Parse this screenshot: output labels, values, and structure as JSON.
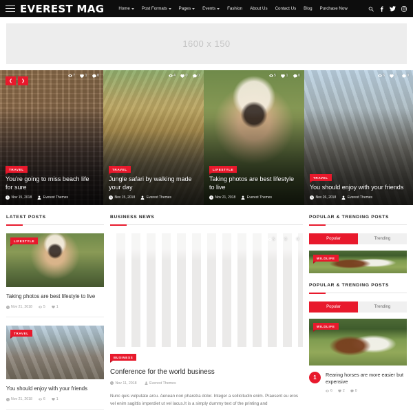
{
  "header": {
    "brand": "EVEREST MAG",
    "menu": [
      {
        "label": "Home",
        "has_dropdown": true
      },
      {
        "label": "Post Formats",
        "has_dropdown": true
      },
      {
        "label": "Pages",
        "has_dropdown": true
      },
      {
        "label": "Events",
        "has_dropdown": true
      },
      {
        "label": "Fashion",
        "has_dropdown": false
      },
      {
        "label": "About Us",
        "has_dropdown": false
      },
      {
        "label": "Contact Us",
        "has_dropdown": false
      },
      {
        "label": "Blog",
        "has_dropdown": false
      },
      {
        "label": "Purchase Now",
        "has_dropdown": false
      }
    ],
    "icons": [
      "search-icon",
      "facebook-icon",
      "twitter-icon",
      "instagram-icon"
    ]
  },
  "ad_banner": {
    "label": "1600 x 150"
  },
  "slider": {
    "prev_label": "❮",
    "next_label": "❯",
    "slides": [
      {
        "category": "TRAVEL",
        "title": "You're going to miss beach life for sure",
        "date": "Nov 15, 2018",
        "author": "Everest Themes",
        "views": "7",
        "likes": "1",
        "comments": "0"
      },
      {
        "category": "TRAVEL",
        "title": "Jungle safari by walking made your day",
        "date": "Nov 15, 2018",
        "author": "Everest Themes",
        "views": "4",
        "likes": "0",
        "comments": "0"
      },
      {
        "category": "LIFESTYLE",
        "title": "Taking photos are best lifestyle to live",
        "date": "Nov 21, 2018",
        "author": "Everest Themes",
        "views": "5",
        "likes": "1",
        "comments": "0"
      },
      {
        "category": "TRAVEL",
        "title": "You should enjoy with your friends",
        "date": "Nov 26, 2018",
        "author": "Everest Themes",
        "views": "6",
        "likes": "1",
        "comments": "0"
      }
    ]
  },
  "latest_posts": {
    "heading": "LATEST POSTS",
    "items": [
      {
        "category": "LIFESTYLE",
        "title": "Taking photos are best lifestyle to live",
        "date": "Nov 21, 2018",
        "views": "5",
        "likes": "1"
      },
      {
        "category": "TRAVEL",
        "title": "You should enjoy with your friends",
        "date": "Nov 21, 2018",
        "views": "6",
        "likes": "1"
      }
    ]
  },
  "business_news": {
    "heading": "BUSINESS NEWS",
    "article": {
      "category": "BUSINESS",
      "title": "Conference for the world business",
      "date": "Nov 11, 2018",
      "author": "Everest Themes",
      "views": "5",
      "likes": "0",
      "comments": "0",
      "excerpt": "Nunc quis vulputate arcu. Aenean non pharetra dolor. Integer a sollicitudin enim. Praesent eu eros vel enim sagittis imperdiet ut vel lacus.It is a simply dummy text of the printing and"
    }
  },
  "sidebar": {
    "widgets": [
      {
        "heading": "POPULAR & TRENDING POSTS",
        "tabs": [
          {
            "label": "Popular",
            "active": true
          },
          {
            "label": "Trending",
            "active": false
          }
        ],
        "post": {
          "category": "WILDLIFE",
          "title": "",
          "rank": "",
          "views": "",
          "likes": "",
          "comments": ""
        }
      },
      {
        "heading": "POPULAR & TRENDING POSTS",
        "tabs": [
          {
            "label": "Popular",
            "active": true
          },
          {
            "label": "Trending",
            "active": false
          }
        ],
        "post": {
          "category": "WILDLIFE",
          "title": "Rearing horses are more easier but expensive",
          "rank": "1",
          "views": "6",
          "likes": "2",
          "comments": "0"
        }
      }
    ]
  },
  "colors": {
    "accent": "#e8192c",
    "nav_background": "#0d0d0d",
    "ad_background": "#ededed"
  }
}
